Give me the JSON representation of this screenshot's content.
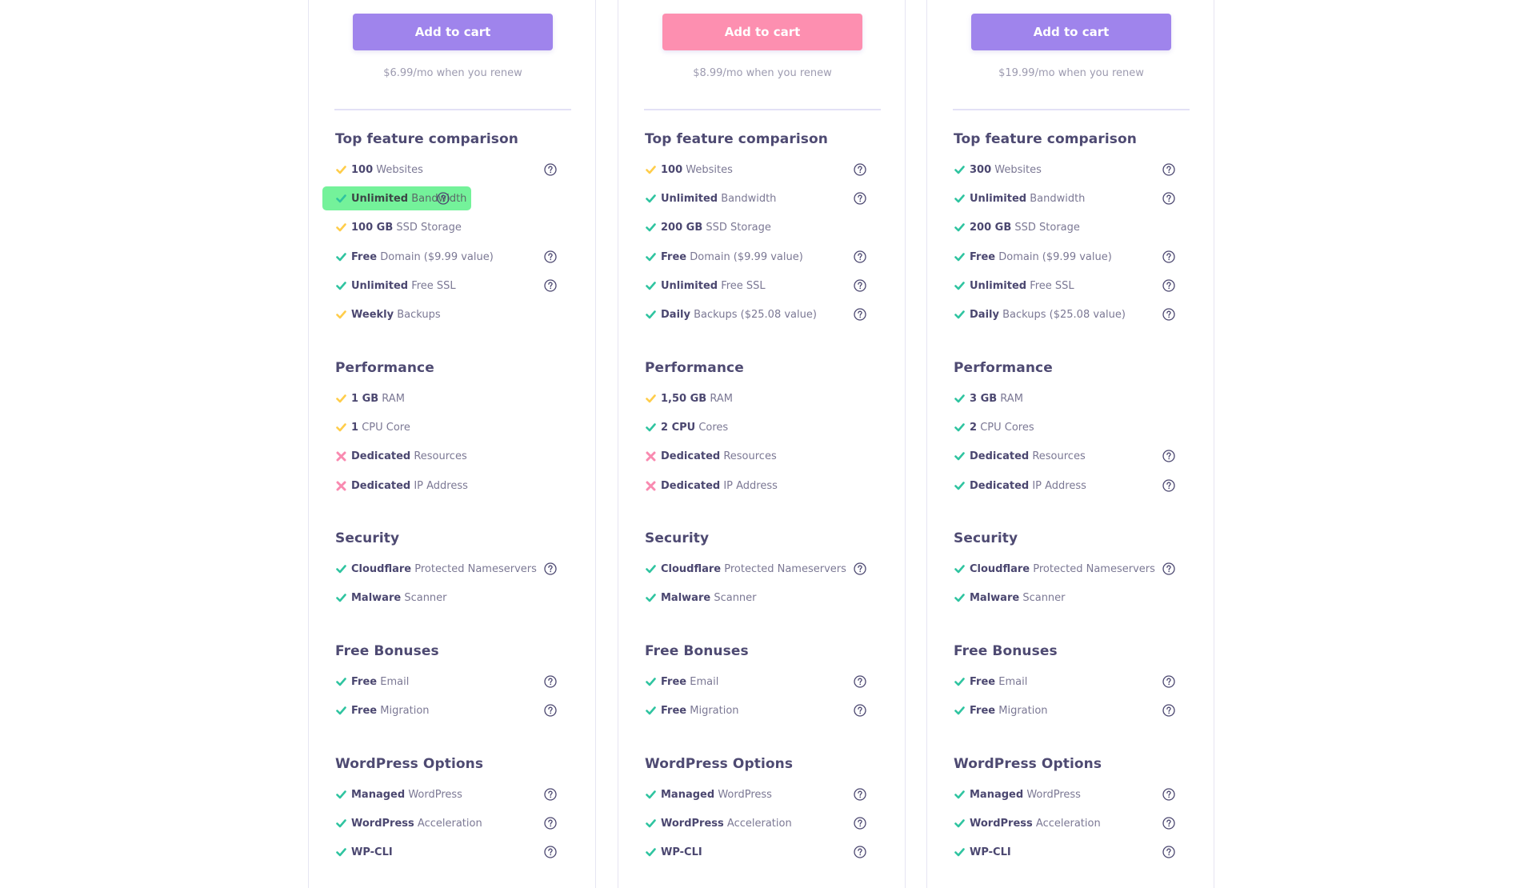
{
  "colors": {
    "button_purple": "#9f84ec",
    "button_pink": "#fd8fb0",
    "check_green": "#2fc4a0",
    "check_yellow": "#ffcd4a",
    "cross_pink": "#f98ab0",
    "highlight_green": "#74f29a",
    "heading": "#4e4a72"
  },
  "plans": [
    {
      "button_label": "Add to cart",
      "button_color": "purple",
      "renew_text": "$6.99/mo when you renew",
      "sections": [
        {
          "title": "Top feature comparison",
          "items": [
            {
              "bold": "100",
              "text": "Websites",
              "status": "partial",
              "help": true
            },
            {
              "bold": "Unlimited",
              "text": "Bandwidth",
              "status": "check",
              "help": true,
              "highlighted": true
            },
            {
              "bold": "100 GB",
              "text": "SSD Storage",
              "status": "partial",
              "help": false
            },
            {
              "bold": "Free",
              "text": "Domain ($9.99 value)",
              "status": "check",
              "help": true
            },
            {
              "bold": "Unlimited",
              "text": "Free SSL",
              "status": "check",
              "help": true
            },
            {
              "bold": "Weekly",
              "text": "Backups",
              "status": "partial",
              "help": false
            }
          ]
        },
        {
          "title": "Performance",
          "items": [
            {
              "bold": "1 GB",
              "text": "RAM",
              "status": "partial",
              "help": false
            },
            {
              "bold": "1",
              "text": "CPU Core",
              "status": "partial",
              "help": false
            },
            {
              "bold": "Dedicated",
              "text": "Resources",
              "status": "cross",
              "help": false
            },
            {
              "bold": "Dedicated",
              "text": "IP Address",
              "status": "cross",
              "help": false
            }
          ]
        },
        {
          "title": "Security",
          "items": [
            {
              "bold": "Cloudflare",
              "text": "Protected Nameservers",
              "status": "check",
              "help": true
            },
            {
              "bold": "Malware",
              "text": "Scanner",
              "status": "check",
              "help": false
            }
          ]
        },
        {
          "title": "Free Bonuses",
          "items": [
            {
              "bold": "Free",
              "text": "Email",
              "status": "check",
              "help": true
            },
            {
              "bold": "Free",
              "text": "Migration",
              "status": "check",
              "help": true
            }
          ]
        },
        {
          "title": "WordPress Options",
          "items": [
            {
              "bold": "Managed",
              "text": "WordPress",
              "status": "check",
              "help": true
            },
            {
              "bold": "WordPress",
              "text": "Acceleration",
              "status": "check",
              "help": true
            },
            {
              "bold": "WP-CLI",
              "text": "",
              "status": "check",
              "help": true
            }
          ]
        }
      ]
    },
    {
      "button_label": "Add to cart",
      "button_color": "pink",
      "renew_text": "$8.99/mo when you renew",
      "sections": [
        {
          "title": "Top feature comparison",
          "items": [
            {
              "bold": "100",
              "text": "Websites",
              "status": "partial",
              "help": true
            },
            {
              "bold": "Unlimited",
              "text": "Bandwidth",
              "status": "check",
              "help": true
            },
            {
              "bold": "200 GB",
              "text": "SSD Storage",
              "status": "check",
              "help": false
            },
            {
              "bold": "Free",
              "text": "Domain ($9.99 value)",
              "status": "check",
              "help": true
            },
            {
              "bold": "Unlimited",
              "text": "Free SSL",
              "status": "check",
              "help": true
            },
            {
              "bold": "Daily",
              "text": "Backups ($25.08 value)",
              "status": "check",
              "help": true
            }
          ]
        },
        {
          "title": "Performance",
          "items": [
            {
              "bold": "1,50 GB",
              "text": "RAM",
              "status": "partial",
              "help": false
            },
            {
              "bold": "2 CPU",
              "text": "Cores",
              "status": "check",
              "help": false
            },
            {
              "bold": "Dedicated",
              "text": "Resources",
              "status": "cross",
              "help": false
            },
            {
              "bold": "Dedicated",
              "text": "IP Address",
              "status": "cross",
              "help": false
            }
          ]
        },
        {
          "title": "Security",
          "items": [
            {
              "bold": "Cloudflare",
              "text": "Protected Nameservers",
              "status": "check",
              "help": true
            },
            {
              "bold": "Malware",
              "text": "Scanner",
              "status": "check",
              "help": false
            }
          ]
        },
        {
          "title": "Free Bonuses",
          "items": [
            {
              "bold": "Free",
              "text": "Email",
              "status": "check",
              "help": true
            },
            {
              "bold": "Free",
              "text": "Migration",
              "status": "check",
              "help": true
            }
          ]
        },
        {
          "title": "WordPress Options",
          "items": [
            {
              "bold": "Managed",
              "text": "WordPress",
              "status": "check",
              "help": true
            },
            {
              "bold": "WordPress",
              "text": "Acceleration",
              "status": "check",
              "help": true
            },
            {
              "bold": "WP-CLI",
              "text": "",
              "status": "check",
              "help": true
            }
          ]
        }
      ]
    },
    {
      "button_label": "Add to cart",
      "button_color": "purple",
      "renew_text": "$19.99/mo when you renew",
      "sections": [
        {
          "title": "Top feature comparison",
          "items": [
            {
              "bold": "300",
              "text": "Websites",
              "status": "check",
              "help": true
            },
            {
              "bold": "Unlimited",
              "text": "Bandwidth",
              "status": "check",
              "help": true
            },
            {
              "bold": "200 GB",
              "text": "SSD Storage",
              "status": "check",
              "help": false
            },
            {
              "bold": "Free",
              "text": "Domain ($9.99 value)",
              "status": "check",
              "help": true
            },
            {
              "bold": "Unlimited",
              "text": "Free SSL",
              "status": "check",
              "help": true
            },
            {
              "bold": "Daily",
              "text": "Backups ($25.08 value)",
              "status": "check",
              "help": true
            }
          ]
        },
        {
          "title": "Performance",
          "items": [
            {
              "bold": "3 GB",
              "text": "RAM",
              "status": "check",
              "help": false
            },
            {
              "bold": "2",
              "text": "CPU Cores",
              "status": "check",
              "help": false
            },
            {
              "bold": "Dedicated",
              "text": "Resources",
              "status": "check",
              "help": true
            },
            {
              "bold": "Dedicated",
              "text": "IP Address",
              "status": "check",
              "help": true
            }
          ]
        },
        {
          "title": "Security",
          "items": [
            {
              "bold": "Cloudflare",
              "text": "Protected Nameservers",
              "status": "check",
              "help": true
            },
            {
              "bold": "Malware",
              "text": "Scanner",
              "status": "check",
              "help": false
            }
          ]
        },
        {
          "title": "Free Bonuses",
          "items": [
            {
              "bold": "Free",
              "text": "Email",
              "status": "check",
              "help": true
            },
            {
              "bold": "Free",
              "text": "Migration",
              "status": "check",
              "help": true
            }
          ]
        },
        {
          "title": "WordPress Options",
          "items": [
            {
              "bold": "Managed",
              "text": "WordPress",
              "status": "check",
              "help": true
            },
            {
              "bold": "WordPress",
              "text": "Acceleration",
              "status": "check",
              "help": true
            },
            {
              "bold": "WP-CLI",
              "text": "",
              "status": "check",
              "help": true
            }
          ]
        }
      ]
    }
  ]
}
